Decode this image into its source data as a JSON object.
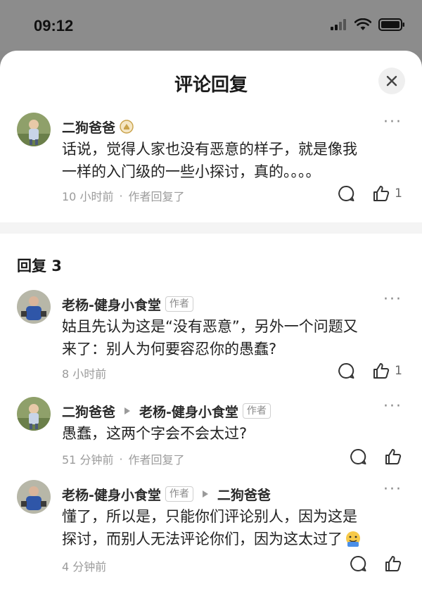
{
  "status": {
    "time": "09:12"
  },
  "sheet": {
    "title": "评论回复"
  },
  "main_comment": {
    "user": "二狗爸爸",
    "text_line1": "话说，觉得人家也没有恶意的样子，就是像我",
    "text_line2": "一样的入门级的一些小探讨，真的。。。。",
    "time": "10 小时前",
    "author_replied": "作者回复了",
    "likes": "1"
  },
  "replies": {
    "header": "回复 3",
    "items": [
      {
        "user": "老杨-健身小食堂",
        "tag": "作者",
        "text_line1": "姑且先认为这是“没有恶意”，另外一个问题又",
        "text_line2": "来了：别人为何要容忍你的愚蠢?",
        "time": "8 小时前",
        "likes": "1"
      },
      {
        "user": "二狗爸爸",
        "reply_to": "老杨-健身小食堂",
        "reply_to_tag": "作者",
        "text_line1": "愚蠢，这两个字会不会太过?",
        "time": "51 分钟前",
        "author_replied": "作者回复了"
      },
      {
        "user": "老杨-健身小食堂",
        "tag": "作者",
        "reply_to": "二狗爸爸",
        "text_line1": "懂了，所以是，只能你们评论别人，因为这是",
        "text_line2": "探讨，而别人无法评论你们，因为这太过了",
        "time": "4 分钟前"
      }
    ]
  },
  "dot_separator": "·",
  "colors": {
    "background_dim": "#8a8a8a",
    "sheet": "#ffffff",
    "meta_text": "#9b9b9b",
    "badge_gold": "#c9a24a"
  },
  "icons": [
    "signal-icon",
    "wifi-icon",
    "battery-icon",
    "close-icon",
    "badge-icon",
    "more-icon",
    "comment-icon",
    "like-icon",
    "arrow-right-icon",
    "emoji-icon"
  ]
}
